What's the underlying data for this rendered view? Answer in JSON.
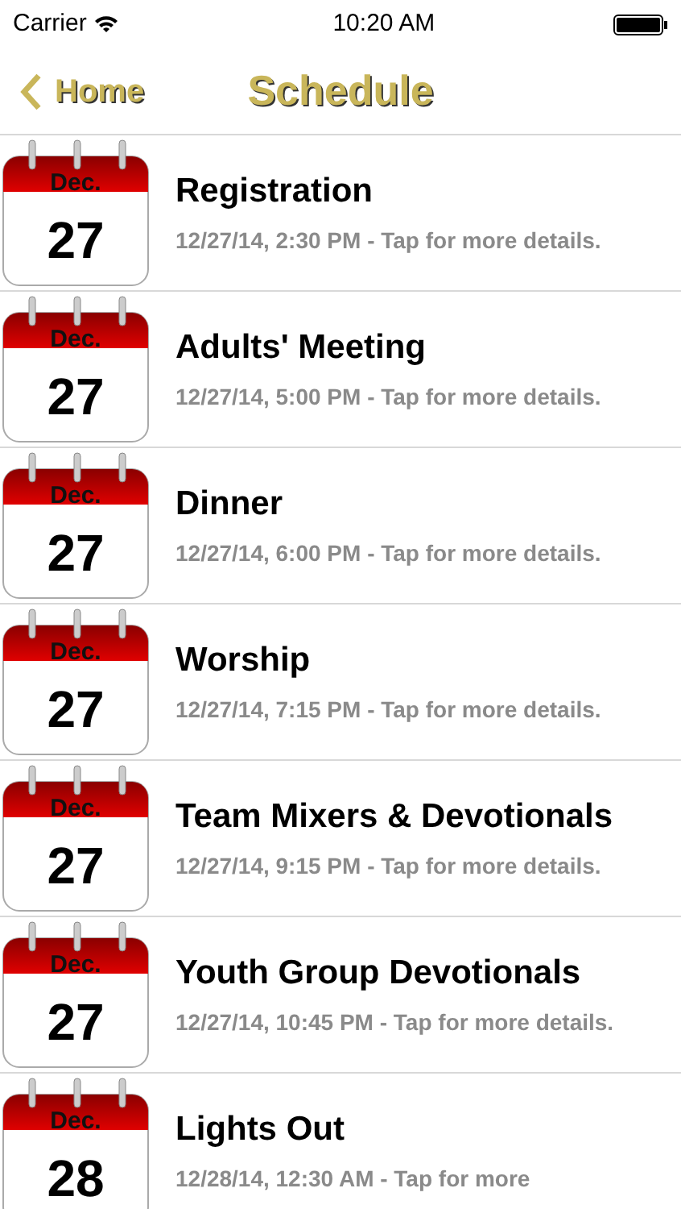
{
  "status_bar": {
    "carrier": "Carrier",
    "time": "10:20 AM"
  },
  "nav": {
    "back": "Home",
    "title": "Schedule"
  },
  "events": [
    {
      "month": "Dec.",
      "day": "27",
      "title": "Registration",
      "subtitle": "12/27/14, 2:30 PM - Tap for more details."
    },
    {
      "month": "Dec.",
      "day": "27",
      "title": "Adults' Meeting",
      "subtitle": "12/27/14, 5:00 PM - Tap for more details."
    },
    {
      "month": "Dec.",
      "day": "27",
      "title": "Dinner",
      "subtitle": "12/27/14, 6:00 PM - Tap for more details."
    },
    {
      "month": "Dec.",
      "day": "27",
      "title": "Worship",
      "subtitle": "12/27/14, 7:15 PM - Tap for more details."
    },
    {
      "month": "Dec.",
      "day": "27",
      "title": "Team Mixers & Devotionals",
      "subtitle": "12/27/14, 9:15 PM - Tap for more details."
    },
    {
      "month": "Dec.",
      "day": "27",
      "title": "Youth Group Devotionals",
      "subtitle": "12/27/14, 10:45 PM - Tap for more details."
    },
    {
      "month": "Dec.",
      "day": "28",
      "title": "Lights Out",
      "subtitle": "12/28/14, 12:30 AM - Tap for more"
    }
  ]
}
